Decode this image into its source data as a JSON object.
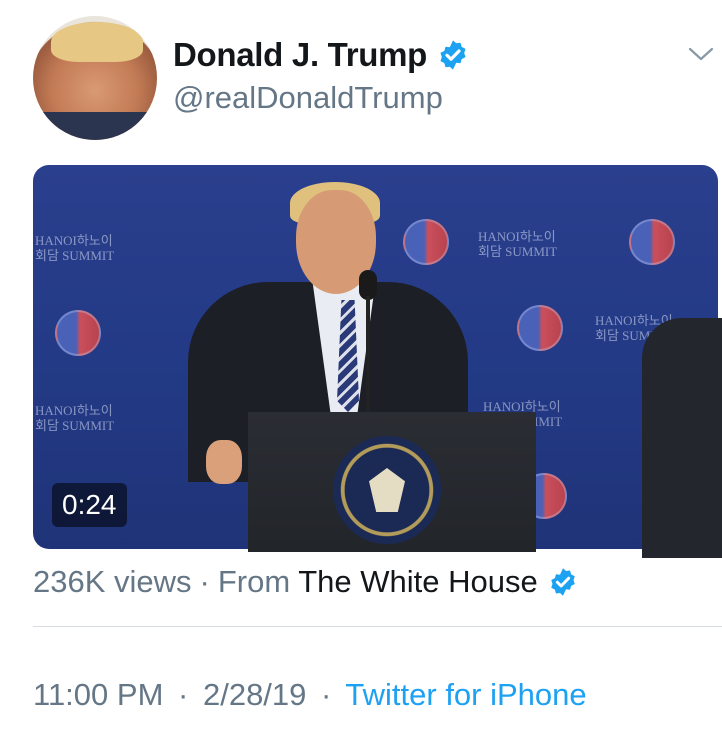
{
  "tweet": {
    "display_name": "Donald J. Trump",
    "handle": "@realDonaldTrump",
    "verified_icon": "verified-badge-icon",
    "accent_color": "#1da1f2"
  },
  "media": {
    "duration": "0:24",
    "backdrop_texts": [
      "HANOI하노이",
      "회담 SUMMIT"
    ]
  },
  "stats": {
    "views": "236K views",
    "separator": "·",
    "from_label": "From",
    "source": "The White House"
  },
  "meta": {
    "time": "11:00 PM",
    "separator": "·",
    "date": "2/28/19",
    "client": "Twitter for iPhone"
  }
}
